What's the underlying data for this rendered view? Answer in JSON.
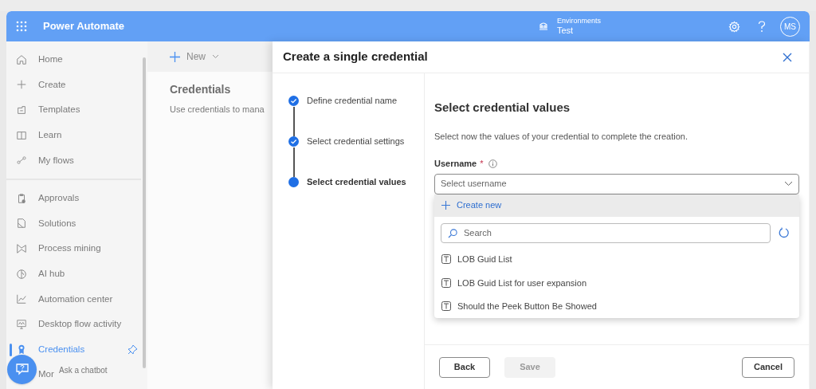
{
  "header": {
    "app_name": "Power Automate",
    "environment_label": "Environments",
    "environment_name": "Test",
    "avatar": "MS"
  },
  "sidebar": {
    "groups": [
      {
        "items": [
          {
            "label": "Home",
            "selected": false
          },
          {
            "label": "Create",
            "selected": false
          },
          {
            "label": "Templates",
            "selected": false
          },
          {
            "label": "Learn",
            "selected": false
          },
          {
            "label": "My flows",
            "selected": false
          }
        ]
      },
      {
        "items": [
          {
            "label": "Approvals",
            "selected": false
          },
          {
            "label": "Solutions",
            "selected": false
          },
          {
            "label": "Process mining",
            "selected": false
          },
          {
            "label": "AI hub",
            "selected": false
          },
          {
            "label": "Automation center",
            "selected": false
          },
          {
            "label": "Desktop flow activity",
            "selected": false
          },
          {
            "label": "Credentials",
            "selected": true
          },
          {
            "label": "Mor",
            "selected": false
          }
        ]
      }
    ],
    "chatbot_label": "Ask a chatbot"
  },
  "main": {
    "new_button": "New",
    "title": "Credentials",
    "description": "Use credentials to mana"
  },
  "panel": {
    "title": "Create a single credential",
    "steps": [
      {
        "label": "Define credential name",
        "done": true,
        "selected": false
      },
      {
        "label": "Select credential settings",
        "done": true,
        "selected": false
      },
      {
        "label": "Select credential values",
        "done": false,
        "selected": true
      }
    ],
    "heading": "Select credential values",
    "description": "Select now the values of your credential to complete the creation.",
    "field": {
      "label": "Username",
      "required_mark": "*",
      "placeholder": "Select username"
    },
    "dropdown": {
      "create_new": "Create new",
      "search_placeholder": "Search",
      "options": [
        {
          "label": "LOB Guid List"
        },
        {
          "label": "LOB Guid List for user expansion"
        },
        {
          "label": "Should the Peek Button Be Showed"
        }
      ]
    },
    "buttons": [
      {
        "label": "Back",
        "kind": "secondary",
        "disabled": false
      },
      {
        "label": "Save",
        "kind": "primary",
        "disabled": true
      },
      {
        "label": "Cancel",
        "kind": "secondary",
        "disabled": false
      }
    ]
  }
}
